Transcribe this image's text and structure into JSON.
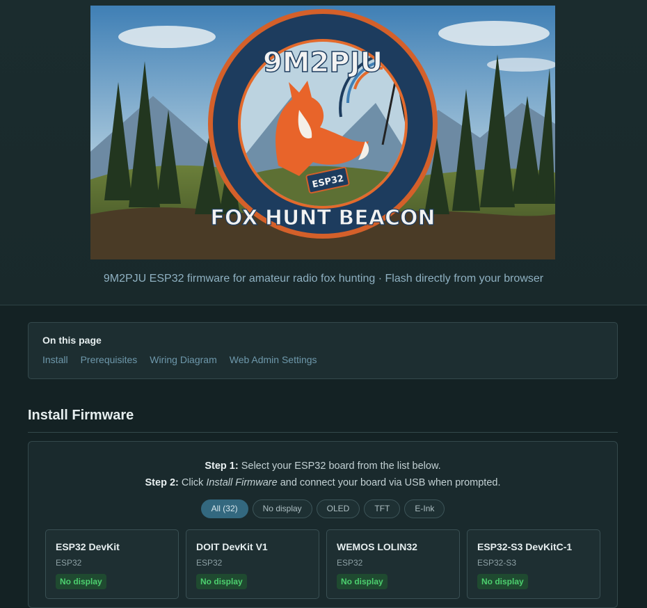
{
  "banner": {
    "logo_callsign": "9M2PJU",
    "logo_tagline": "FOX HUNT BEACON",
    "logo_chip": "ESP32"
  },
  "subtitle": "9M2PJU ESP32 firmware for amateur radio fox hunting · Flash directly from your browser",
  "toc": {
    "title": "On this page",
    "links": [
      "Install",
      "Prerequisites",
      "Wiring Diagram",
      "Web Admin Settings"
    ]
  },
  "section_title": "Install Firmware",
  "steps": {
    "step1_label": "Step 1:",
    "step1_text": "Select your ESP32 board from the list below.",
    "step2_label": "Step 2:",
    "step2_pre": "Click",
    "step2_em": "Install Firmware",
    "step2_post": "and connect your board via USB when prompted."
  },
  "filters": [
    {
      "label": "All (32)",
      "active": true
    },
    {
      "label": "No display",
      "active": false
    },
    {
      "label": "OLED",
      "active": false
    },
    {
      "label": "TFT",
      "active": false
    },
    {
      "label": "E-Ink",
      "active": false
    }
  ],
  "boards": [
    {
      "name": "ESP32 DevKit",
      "chip": "ESP32",
      "display": "No display"
    },
    {
      "name": "DOIT DevKit V1",
      "chip": "ESP32",
      "display": "No display"
    },
    {
      "name": "WEMOS LOLIN32",
      "chip": "ESP32",
      "display": "No display"
    },
    {
      "name": "ESP32-S3 DevKitC-1",
      "chip": "ESP32-S3",
      "display": "No display"
    }
  ],
  "colors": {
    "background": "#142224",
    "accent": "#33687f",
    "badge_green": "#4ccf6e"
  }
}
